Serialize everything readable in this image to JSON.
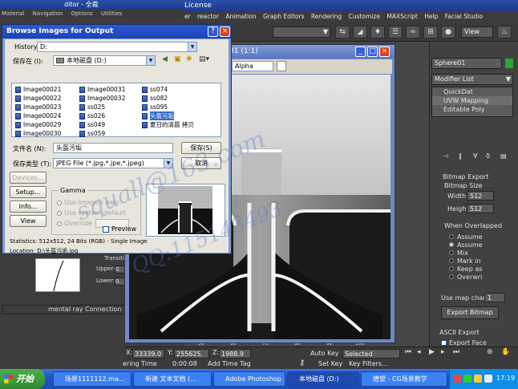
{
  "max": {
    "title": "License",
    "menu": [
      "er",
      "reactor",
      "Animation",
      "Graph Editors",
      "Rendering",
      "Customize",
      "MAXScript",
      "Help",
      "Facial Studio"
    ],
    "view_combo": "View",
    "left_editor": {
      "title": "ditor - 全裁",
      "menu": [
        "Material",
        "Navigation",
        "Options",
        "Utilities"
      ],
      "transition_label": "Transiti",
      "upper_label": "Upper:",
      "upper_value": "0.",
      "lower_label": "Lower:",
      "lower_value": "0.",
      "mental_ray": "mental ray Connection"
    },
    "command_panel": {
      "object_name": "Sphere01",
      "object_color": "#22aa33",
      "modifier_list": "Modifier List",
      "stack": [
        "QuickDat",
        "UVW Mapping",
        "Editable Poly"
      ],
      "bitmap_export": "Bitmap Export",
      "bitmap_size": "Bitmap Size",
      "width_label": "Width:",
      "width_value": "512",
      "height_label": "Height",
      "height_value": "512",
      "when_overlapped": "When Overlapped",
      "overlap_options": [
        "Assume",
        "Assume",
        "Mix",
        "Mark in",
        "Keep as",
        "Overwri"
      ],
      "overlap_selected": 1,
      "use_map_chan_label": "Use map chan:",
      "use_map_chan_value": "1",
      "export_bitmap": "Export Bitmap",
      "ascii_export": "ASCII Export",
      "export_face": "Export Face"
    },
    "status": {
      "x_label": "X:",
      "x_value": "33339.0",
      "y_label": "Y:",
      "y_value": "255625.",
      "z_label": "Z:",
      "z_value": "1988.9",
      "auto_key": "Auto Key",
      "auto_key_value": "Selected",
      "set_key": "Set Key",
      "key_filters": "Key Filters...",
      "ruler_ticks": [
        "50",
        "60",
        "70",
        "80",
        "90",
        "100"
      ],
      "rendering_time": "ering Time",
      "rendering_time_value": "0:00:08",
      "add_time_tag": "Add Time Tag"
    }
  },
  "viewer": {
    "title": "01 (1:1)",
    "toolbar_combo": "Alpha"
  },
  "dialog": {
    "title": "Browse Images for Output",
    "history_label": "History:",
    "history_value": "D:",
    "save_in_label": "保存在 (I):",
    "save_in_value": "本地磁盘 (D:)",
    "files_col1": [
      "Image00021",
      "Image00022",
      "Image00023",
      "Image00024",
      "Image00029",
      "Image00030"
    ],
    "files_col2": [
      "Image00031",
      "Image00032",
      "ss025",
      "ss026",
      "ss049",
      "ss059"
    ],
    "files_col3": [
      "ss074",
      "ss082",
      "ss095",
      "头盔污垢",
      "夏日的清晨 拷贝",
      ""
    ],
    "selected_file": "头盔污垢",
    "filename_label": "文件名 (N):",
    "filename_value": "头盔污垢",
    "filetype_label": "保存类型 (T):",
    "filetype_value": "JPEG File (*.jpg,*.jpe,*.jpeg)",
    "save_button": "保存(S)",
    "cancel_button": "取消",
    "devices_button": "Devices...",
    "setup_button": "Setup...",
    "info_button": "Info...",
    "view_button": "View",
    "gamma_title": "Gamma",
    "gamma_options": [
      "Use image's own",
      "Use system default",
      "Override"
    ],
    "preview_label": "Preview",
    "statistics": "Statistics: 512x512, 24 Bits (RGB) - Single Image",
    "location": "Location: D:\\头盔污垢.jpg"
  },
  "taskbar": {
    "start": "开始",
    "items": [
      "场景1111112.ma...",
      "新建 文本文档 (...",
      "Adobe Photoshop",
      "本地磁盘 (D:)",
      "德望 - CG场景教学"
    ],
    "active_index": 3,
    "clock": "17:19"
  },
  "watermark": [
    "squall@163.com",
    "QQ:115143493"
  ]
}
